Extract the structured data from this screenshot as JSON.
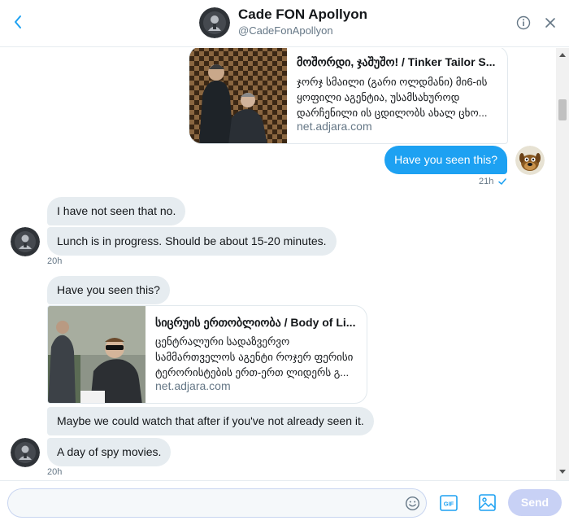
{
  "header": {
    "name": "Cade FON Apollyon",
    "handle": "@CadeFonApollyon"
  },
  "messages": {
    "card_top": {
      "title": "მოშორდი, ჯაშუშო! / Tinker Tailor S...",
      "desc_lines": [
        "ჯორჯ სმაილი (გარი ოლდმანი) მი6-ის",
        "ყოფილი აგენტია, უსამსახუროდ",
        "დარჩენილი ის ცდილობს ახალ ცხო..."
      ],
      "domain": "net.adjara.com"
    },
    "out_1": {
      "text": "Have you seen this?",
      "time": "21h"
    },
    "group_1": {
      "m1": "I have not seen that no.",
      "m2": "Lunch is in progress. Should be about 15-20 minutes.",
      "time": "20h"
    },
    "group_2": {
      "m1": "Have you seen this?",
      "card": {
        "title": "სიცრუის ერთობლიობა / Body of Li...",
        "desc_lines": [
          "ცენტრალური სადაზვერვო",
          "სამმართველოს აგენტი როჯერ ფერისი",
          "ტერორისტების ერთ-ერთ ლიდერს გ..."
        ],
        "domain": "net.adjara.com"
      },
      "m2": "Maybe we could watch that after if you've not already seen it.",
      "m3": "A day of spy movies.",
      "time": "20h"
    }
  },
  "composer": {
    "placeholder": "",
    "send_label": "Send",
    "gif_label": "GIF"
  },
  "colors": {
    "accent": "#1da1f2",
    "bubble_in": "#e6ecf0",
    "send_disabled": "#c8d1f5"
  }
}
